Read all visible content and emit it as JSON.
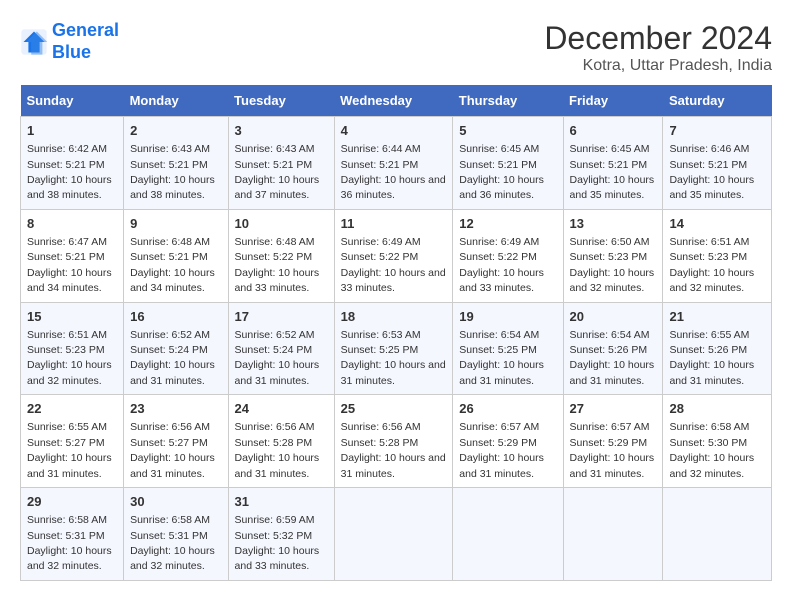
{
  "header": {
    "logo_line1": "General",
    "logo_line2": "Blue",
    "main_title": "December 2024",
    "subtitle": "Kotra, Uttar Pradesh, India"
  },
  "weekdays": [
    "Sunday",
    "Monday",
    "Tuesday",
    "Wednesday",
    "Thursday",
    "Friday",
    "Saturday"
  ],
  "weeks": [
    [
      {
        "day": "1",
        "sunrise": "6:42 AM",
        "sunset": "5:21 PM",
        "daylight": "10 hours and 38 minutes."
      },
      {
        "day": "2",
        "sunrise": "6:43 AM",
        "sunset": "5:21 PM",
        "daylight": "10 hours and 38 minutes."
      },
      {
        "day": "3",
        "sunrise": "6:43 AM",
        "sunset": "5:21 PM",
        "daylight": "10 hours and 37 minutes."
      },
      {
        "day": "4",
        "sunrise": "6:44 AM",
        "sunset": "5:21 PM",
        "daylight": "10 hours and 36 minutes."
      },
      {
        "day": "5",
        "sunrise": "6:45 AM",
        "sunset": "5:21 PM",
        "daylight": "10 hours and 36 minutes."
      },
      {
        "day": "6",
        "sunrise": "6:45 AM",
        "sunset": "5:21 PM",
        "daylight": "10 hours and 35 minutes."
      },
      {
        "day": "7",
        "sunrise": "6:46 AM",
        "sunset": "5:21 PM",
        "daylight": "10 hours and 35 minutes."
      }
    ],
    [
      {
        "day": "8",
        "sunrise": "6:47 AM",
        "sunset": "5:21 PM",
        "daylight": "10 hours and 34 minutes."
      },
      {
        "day": "9",
        "sunrise": "6:48 AM",
        "sunset": "5:21 PM",
        "daylight": "10 hours and 34 minutes."
      },
      {
        "day": "10",
        "sunrise": "6:48 AM",
        "sunset": "5:22 PM",
        "daylight": "10 hours and 33 minutes."
      },
      {
        "day": "11",
        "sunrise": "6:49 AM",
        "sunset": "5:22 PM",
        "daylight": "10 hours and 33 minutes."
      },
      {
        "day": "12",
        "sunrise": "6:49 AM",
        "sunset": "5:22 PM",
        "daylight": "10 hours and 33 minutes."
      },
      {
        "day": "13",
        "sunrise": "6:50 AM",
        "sunset": "5:23 PM",
        "daylight": "10 hours and 32 minutes."
      },
      {
        "day": "14",
        "sunrise": "6:51 AM",
        "sunset": "5:23 PM",
        "daylight": "10 hours and 32 minutes."
      }
    ],
    [
      {
        "day": "15",
        "sunrise": "6:51 AM",
        "sunset": "5:23 PM",
        "daylight": "10 hours and 32 minutes."
      },
      {
        "day": "16",
        "sunrise": "6:52 AM",
        "sunset": "5:24 PM",
        "daylight": "10 hours and 31 minutes."
      },
      {
        "day": "17",
        "sunrise": "6:52 AM",
        "sunset": "5:24 PM",
        "daylight": "10 hours and 31 minutes."
      },
      {
        "day": "18",
        "sunrise": "6:53 AM",
        "sunset": "5:25 PM",
        "daylight": "10 hours and 31 minutes."
      },
      {
        "day": "19",
        "sunrise": "6:54 AM",
        "sunset": "5:25 PM",
        "daylight": "10 hours and 31 minutes."
      },
      {
        "day": "20",
        "sunrise": "6:54 AM",
        "sunset": "5:26 PM",
        "daylight": "10 hours and 31 minutes."
      },
      {
        "day": "21",
        "sunrise": "6:55 AM",
        "sunset": "5:26 PM",
        "daylight": "10 hours and 31 minutes."
      }
    ],
    [
      {
        "day": "22",
        "sunrise": "6:55 AM",
        "sunset": "5:27 PM",
        "daylight": "10 hours and 31 minutes."
      },
      {
        "day": "23",
        "sunrise": "6:56 AM",
        "sunset": "5:27 PM",
        "daylight": "10 hours and 31 minutes."
      },
      {
        "day": "24",
        "sunrise": "6:56 AM",
        "sunset": "5:28 PM",
        "daylight": "10 hours and 31 minutes."
      },
      {
        "day": "25",
        "sunrise": "6:56 AM",
        "sunset": "5:28 PM",
        "daylight": "10 hours and 31 minutes."
      },
      {
        "day": "26",
        "sunrise": "6:57 AM",
        "sunset": "5:29 PM",
        "daylight": "10 hours and 31 minutes."
      },
      {
        "day": "27",
        "sunrise": "6:57 AM",
        "sunset": "5:29 PM",
        "daylight": "10 hours and 31 minutes."
      },
      {
        "day": "28",
        "sunrise": "6:58 AM",
        "sunset": "5:30 PM",
        "daylight": "10 hours and 32 minutes."
      }
    ],
    [
      {
        "day": "29",
        "sunrise": "6:58 AM",
        "sunset": "5:31 PM",
        "daylight": "10 hours and 32 minutes."
      },
      {
        "day": "30",
        "sunrise": "6:58 AM",
        "sunset": "5:31 PM",
        "daylight": "10 hours and 32 minutes."
      },
      {
        "day": "31",
        "sunrise": "6:59 AM",
        "sunset": "5:32 PM",
        "daylight": "10 hours and 33 minutes."
      },
      null,
      null,
      null,
      null
    ]
  ]
}
